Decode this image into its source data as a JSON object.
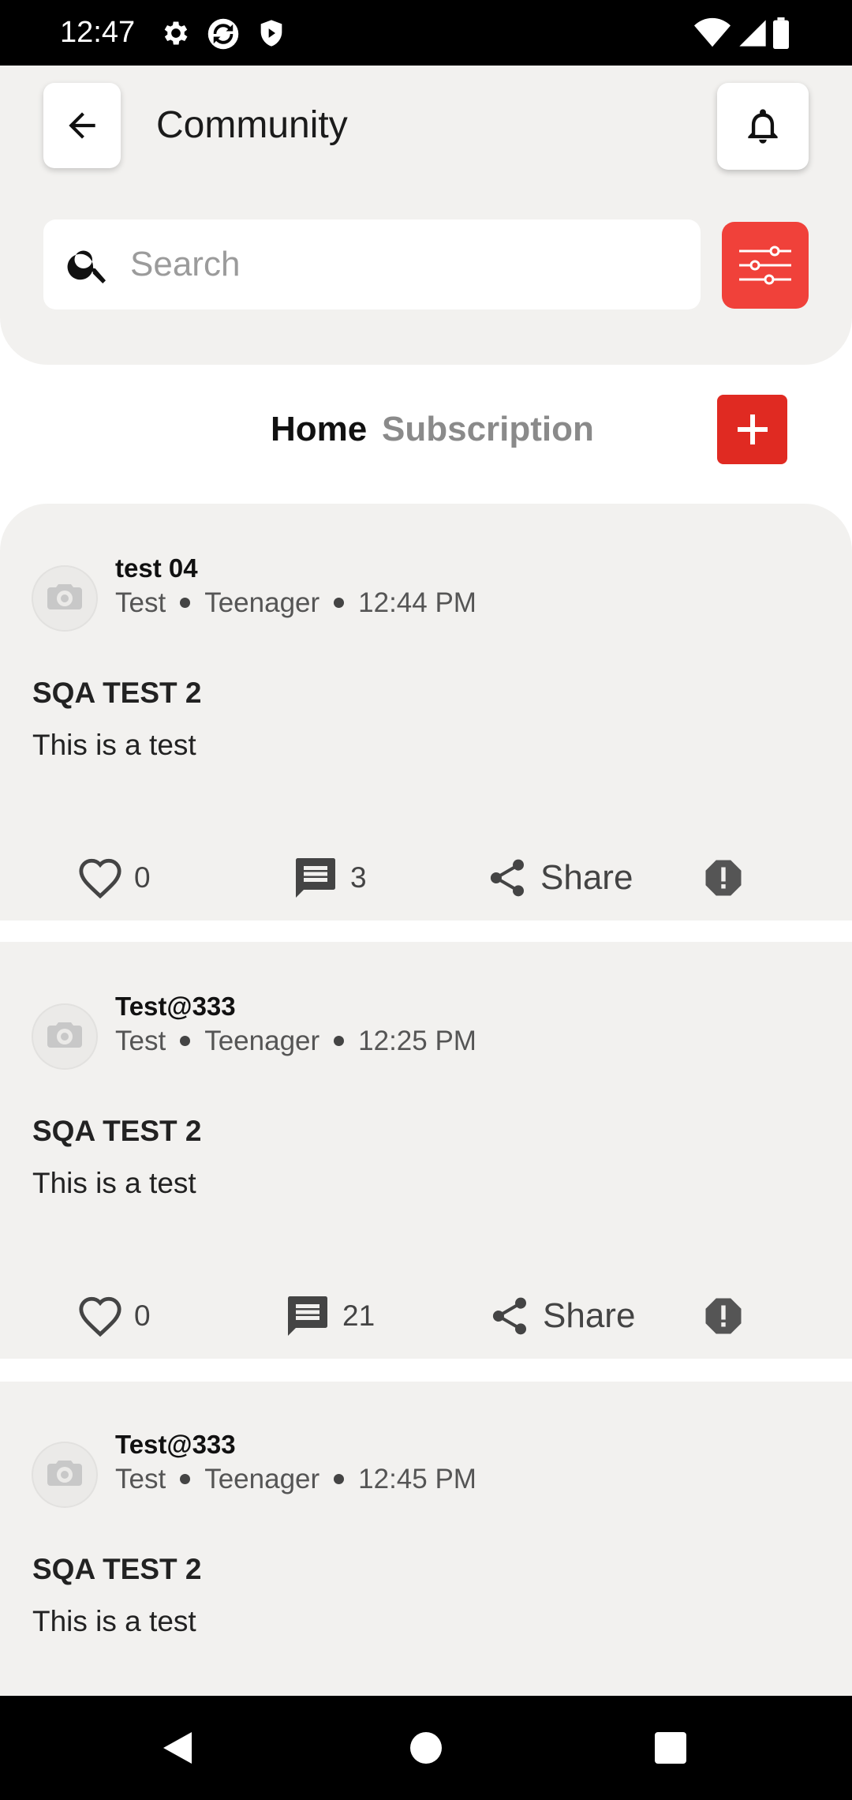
{
  "status_bar": {
    "time": "12:47"
  },
  "header": {
    "title": "Community",
    "search_placeholder": "Search"
  },
  "tabs": [
    {
      "label": "Home",
      "active": true
    },
    {
      "label": "Subscription",
      "active": false
    }
  ],
  "posts": [
    {
      "author": "test 04",
      "category": "Test",
      "audience": "Teenager",
      "time": "12:44 PM",
      "title": "SQA TEST 2",
      "body": "This is a test",
      "likes": "0",
      "comments": "3",
      "share_label": "Share"
    },
    {
      "author": "Test@333",
      "category": "Test",
      "audience": "Teenager",
      "time": "12:25 PM",
      "title": "SQA TEST 2",
      "body": "This is a test",
      "likes": "0",
      "comments": "21",
      "share_label": "Share"
    },
    {
      "author": "Test@333",
      "category": "Test",
      "audience": "Teenager",
      "time": "12:45 PM",
      "title": "SQA TEST 2",
      "body": "This is a test"
    }
  ],
  "colors": {
    "accent_red": "#f0413a",
    "add_red": "#e02a22",
    "panel_bg": "#f2f1ef"
  }
}
